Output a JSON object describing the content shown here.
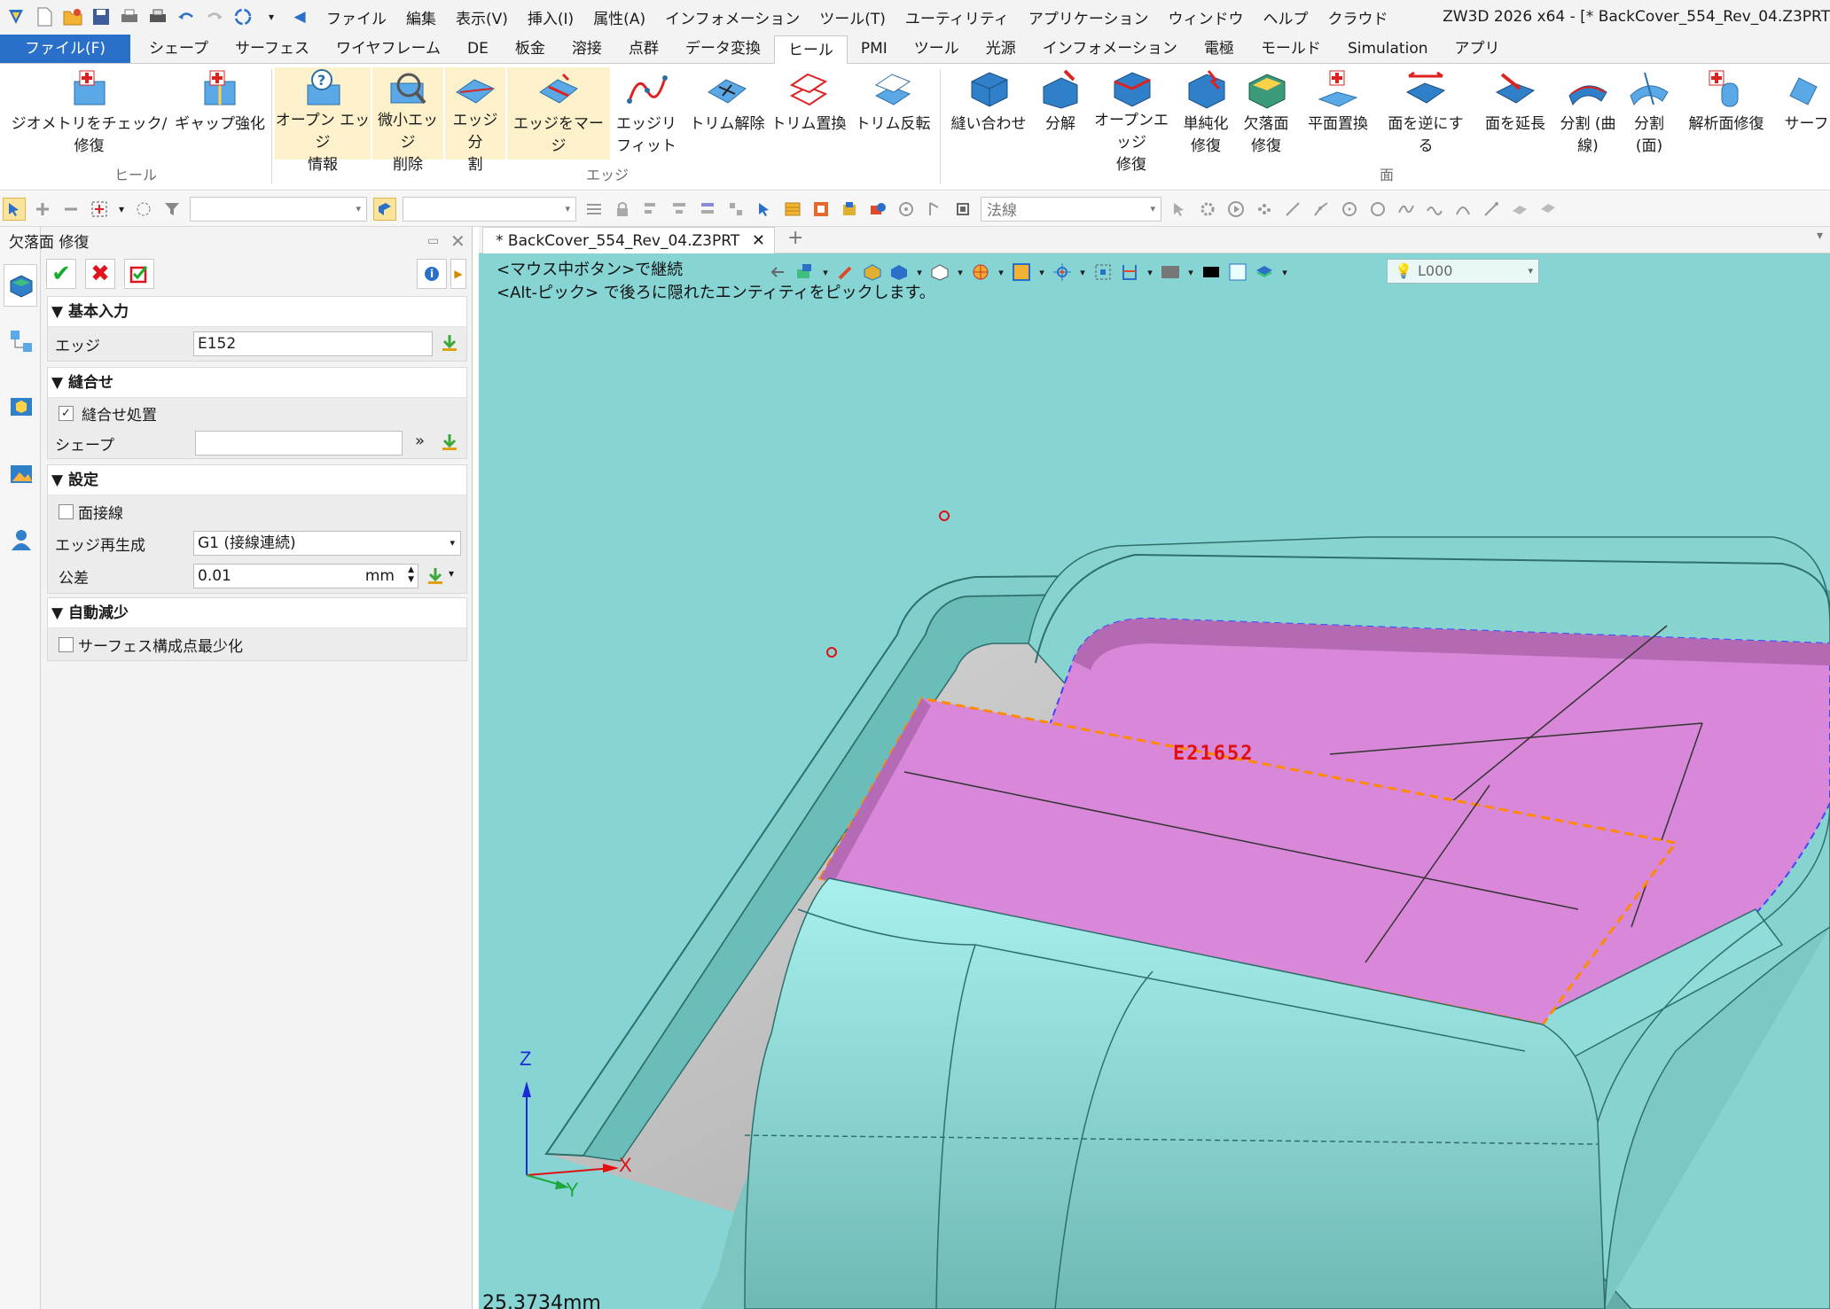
{
  "titlebar": {
    "menu": [
      "ファイル",
      "編集",
      "表示(V)",
      "挿入(I)",
      "属性(A)",
      "インフォメーション",
      "ツール(T)",
      "ユーティリティ",
      "アプリケーション",
      "ウィンドウ",
      "ヘルプ",
      "クラウド"
    ],
    "window_title": "ZW3D 2026 x64 - [* BackCover_554_Rev_04.Z3PRT"
  },
  "ribbon_tabs": [
    "ファイル(F)",
    "シェープ",
    "サーフェス",
    "ワイヤフレーム",
    "DE",
    "板金",
    "溶接",
    "点群",
    "データ変換",
    "ヒール",
    "PMI",
    "ツール",
    "光源",
    "インフォメーション",
    "電極",
    "モールド",
    "Simulation",
    "アプリ"
  ],
  "ribbon_active_tab": "ヒール",
  "ribbon": {
    "groups": [
      "ヒール",
      "エッジ",
      "面"
    ],
    "buttons": [
      {
        "label": "ジオメトリをチェック/修復",
        "icon": "check-geometry-icon"
      },
      {
        "label": "ギャップ強化",
        "icon": "gap-enhance-icon"
      },
      {
        "label": "オープン エッジ\n情報",
        "icon": "open-edge-info-icon"
      },
      {
        "label": "微小エッジ\n削除",
        "icon": "small-edge-delete-icon"
      },
      {
        "label": "エッジ 分\n割",
        "icon": "edge-split-icon"
      },
      {
        "label": "エッジをマージ",
        "icon": "edge-merge-icon"
      },
      {
        "label": "エッジリ\nフィット",
        "icon": "edge-refit-icon"
      },
      {
        "label": "トリム解除",
        "icon": "untrim-icon"
      },
      {
        "label": "トリム置換",
        "icon": "trim-replace-icon"
      },
      {
        "label": "トリム反転",
        "icon": "trim-reverse-icon"
      },
      {
        "label": "縫い合わせ",
        "icon": "sew-icon"
      },
      {
        "label": "分解",
        "icon": "explode-icon"
      },
      {
        "label": "オープンエッジ\n修復",
        "icon": "open-edge-repair-icon"
      },
      {
        "label": "単純化\n修復",
        "icon": "simplify-repair-icon"
      },
      {
        "label": "欠落面\n修復",
        "icon": "missing-face-repair-icon"
      },
      {
        "label": "平面置換",
        "icon": "planar-replace-icon"
      },
      {
        "label": "面を逆にする",
        "icon": "reverse-face-icon"
      },
      {
        "label": "面を延長",
        "icon": "extend-face-icon"
      },
      {
        "label": "分割 (曲\n線)",
        "icon": "split-curve-icon"
      },
      {
        "label": "分割\n(面)",
        "icon": "split-face-icon"
      },
      {
        "label": "解析面修復",
        "icon": "analytic-repair-icon"
      },
      {
        "label": "サーフェ",
        "icon": "surface-icon"
      }
    ]
  },
  "toolbar": {
    "filter_value": "",
    "pick_value": "",
    "normal_combo": "法線"
  },
  "panel": {
    "title": "欠落面 修復",
    "sections": {
      "basic": {
        "header": "基本入力",
        "edge_label": "エッジ",
        "edge_value": "E152"
      },
      "sew": {
        "header": "縫合せ",
        "sew_check_label": "縫合せ処置",
        "sew_checked": true,
        "shape_label": "シェープ",
        "shape_value": ""
      },
      "settings": {
        "header": "設定",
        "tangent_label": "面接線",
        "tangent_checked": false,
        "regen_label": "エッジ再生成",
        "regen_value": "G1 (接線連続)",
        "tolerance_label": "公差",
        "tolerance_value": "0.01",
        "tolerance_unit": "mm"
      },
      "auto": {
        "header": "自動減少",
        "minimize_label": "サーフェス構成点最少化",
        "minimize_checked": false
      }
    }
  },
  "document": {
    "tab_label": "* BackCover_554_Rev_04.Z3PRT",
    "hint1": "<マウス中ボタン>で継続",
    "hint2": "<Alt-ピック> で後ろに隠れたエンティティをピックします。",
    "layer": "L000",
    "edge_label": "E21652",
    "distance": "25.3734mm",
    "axes": {
      "x": "X",
      "y": "Y",
      "z": "Z"
    }
  },
  "colors": {
    "viewport_bg": "#87d4d4",
    "model": "#8fdcda",
    "selected_face": "#d884d8",
    "highlight_edge": "#ff8a00",
    "label_red": "#e01010"
  }
}
